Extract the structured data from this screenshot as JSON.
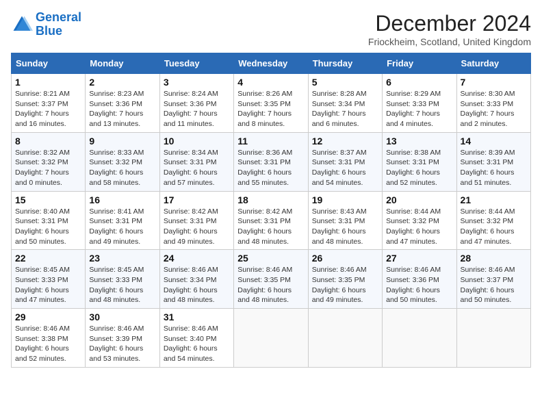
{
  "logo": {
    "line1": "General",
    "line2": "Blue"
  },
  "header": {
    "month": "December 2024",
    "location": "Friockheim, Scotland, United Kingdom"
  },
  "weekdays": [
    "Sunday",
    "Monday",
    "Tuesday",
    "Wednesday",
    "Thursday",
    "Friday",
    "Saturday"
  ],
  "weeks": [
    [
      {
        "day": 1,
        "sunrise": "8:21 AM",
        "sunset": "3:37 PM",
        "daylight": "7 hours and 16 minutes."
      },
      {
        "day": 2,
        "sunrise": "8:23 AM",
        "sunset": "3:36 PM",
        "daylight": "7 hours and 13 minutes."
      },
      {
        "day": 3,
        "sunrise": "8:24 AM",
        "sunset": "3:36 PM",
        "daylight": "7 hours and 11 minutes."
      },
      {
        "day": 4,
        "sunrise": "8:26 AM",
        "sunset": "3:35 PM",
        "daylight": "7 hours and 8 minutes."
      },
      {
        "day": 5,
        "sunrise": "8:28 AM",
        "sunset": "3:34 PM",
        "daylight": "7 hours and 6 minutes."
      },
      {
        "day": 6,
        "sunrise": "8:29 AM",
        "sunset": "3:33 PM",
        "daylight": "7 hours and 4 minutes."
      },
      {
        "day": 7,
        "sunrise": "8:30 AM",
        "sunset": "3:33 PM",
        "daylight": "7 hours and 2 minutes."
      }
    ],
    [
      {
        "day": 8,
        "sunrise": "8:32 AM",
        "sunset": "3:32 PM",
        "daylight": "7 hours and 0 minutes."
      },
      {
        "day": 9,
        "sunrise": "8:33 AM",
        "sunset": "3:32 PM",
        "daylight": "6 hours and 58 minutes."
      },
      {
        "day": 10,
        "sunrise": "8:34 AM",
        "sunset": "3:31 PM",
        "daylight": "6 hours and 57 minutes."
      },
      {
        "day": 11,
        "sunrise": "8:36 AM",
        "sunset": "3:31 PM",
        "daylight": "6 hours and 55 minutes."
      },
      {
        "day": 12,
        "sunrise": "8:37 AM",
        "sunset": "3:31 PM",
        "daylight": "6 hours and 54 minutes."
      },
      {
        "day": 13,
        "sunrise": "8:38 AM",
        "sunset": "3:31 PM",
        "daylight": "6 hours and 52 minutes."
      },
      {
        "day": 14,
        "sunrise": "8:39 AM",
        "sunset": "3:31 PM",
        "daylight": "6 hours and 51 minutes."
      }
    ],
    [
      {
        "day": 15,
        "sunrise": "8:40 AM",
        "sunset": "3:31 PM",
        "daylight": "6 hours and 50 minutes."
      },
      {
        "day": 16,
        "sunrise": "8:41 AM",
        "sunset": "3:31 PM",
        "daylight": "6 hours and 49 minutes."
      },
      {
        "day": 17,
        "sunrise": "8:42 AM",
        "sunset": "3:31 PM",
        "daylight": "6 hours and 49 minutes."
      },
      {
        "day": 18,
        "sunrise": "8:42 AM",
        "sunset": "3:31 PM",
        "daylight": "6 hours and 48 minutes."
      },
      {
        "day": 19,
        "sunrise": "8:43 AM",
        "sunset": "3:31 PM",
        "daylight": "6 hours and 48 minutes."
      },
      {
        "day": 20,
        "sunrise": "8:44 AM",
        "sunset": "3:32 PM",
        "daylight": "6 hours and 47 minutes."
      },
      {
        "day": 21,
        "sunrise": "8:44 AM",
        "sunset": "3:32 PM",
        "daylight": "6 hours and 47 minutes."
      }
    ],
    [
      {
        "day": 22,
        "sunrise": "8:45 AM",
        "sunset": "3:33 PM",
        "daylight": "6 hours and 47 minutes."
      },
      {
        "day": 23,
        "sunrise": "8:45 AM",
        "sunset": "3:33 PM",
        "daylight": "6 hours and 48 minutes."
      },
      {
        "day": 24,
        "sunrise": "8:46 AM",
        "sunset": "3:34 PM",
        "daylight": "6 hours and 48 minutes."
      },
      {
        "day": 25,
        "sunrise": "8:46 AM",
        "sunset": "3:35 PM",
        "daylight": "6 hours and 48 minutes."
      },
      {
        "day": 26,
        "sunrise": "8:46 AM",
        "sunset": "3:35 PM",
        "daylight": "6 hours and 49 minutes."
      },
      {
        "day": 27,
        "sunrise": "8:46 AM",
        "sunset": "3:36 PM",
        "daylight": "6 hours and 50 minutes."
      },
      {
        "day": 28,
        "sunrise": "8:46 AM",
        "sunset": "3:37 PM",
        "daylight": "6 hours and 50 minutes."
      }
    ],
    [
      {
        "day": 29,
        "sunrise": "8:46 AM",
        "sunset": "3:38 PM",
        "daylight": "6 hours and 52 minutes."
      },
      {
        "day": 30,
        "sunrise": "8:46 AM",
        "sunset": "3:39 PM",
        "daylight": "6 hours and 53 minutes."
      },
      {
        "day": 31,
        "sunrise": "8:46 AM",
        "sunset": "3:40 PM",
        "daylight": "6 hours and 54 minutes."
      },
      null,
      null,
      null,
      null
    ]
  ]
}
